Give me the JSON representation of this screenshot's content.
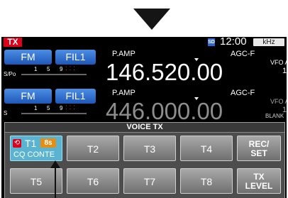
{
  "status": {
    "tx": "TX",
    "sd": "SD",
    "time": "12:00",
    "step": "kHz"
  },
  "vfo_main": {
    "mode": "FM",
    "filter": "FIL1",
    "meter_label": "S/Po",
    "preamp": "P.AMP",
    "agc": "AGC-F",
    "frequency": "146.520.00",
    "vfo": "VFO A",
    "vfo_num": "1"
  },
  "vfo_sub": {
    "mode": "FM",
    "filter": "FIL1",
    "meter_label": "S",
    "preamp": "P.AMP",
    "agc": "AGC-F",
    "frequency": "446.000.00",
    "vfo": "VFO A",
    "vfo_num": "1",
    "blank": "BLANK"
  },
  "meter_scale": [
    "1",
    "5",
    "9"
  ],
  "voice_tx": {
    "title": "VOICE TX",
    "t1_label": "T1",
    "t1_timer": "8s",
    "t1_text": "CQ CONTE",
    "buttons": [
      "T2",
      "T3",
      "T4",
      "T5",
      "T6",
      "T7",
      "T8"
    ],
    "rec_set": [
      "REC/",
      "SET"
    ],
    "tx_level": [
      "TX",
      "LEVEL"
    ]
  },
  "colors": {
    "accent_blue": "#2f6fd1",
    "tx_red": "#e0001a",
    "timer_orange": "#e58e16",
    "t1_active": "#5ab3d0"
  }
}
